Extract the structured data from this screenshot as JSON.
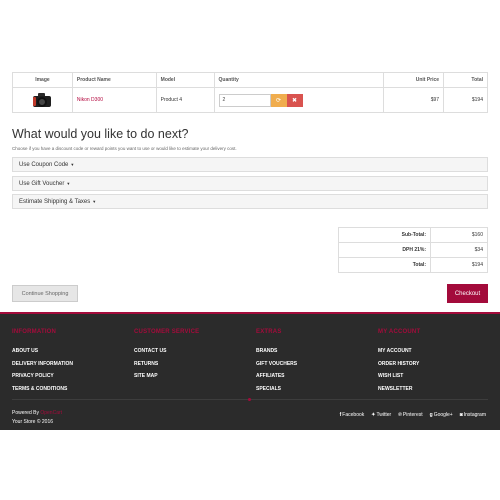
{
  "cart": {
    "columns": [
      "Image",
      "Product Name",
      "Model",
      "Quantity",
      "Unit Price",
      "Total"
    ],
    "rows": [
      {
        "image_icon": "camera-icon",
        "name": "Nikon D300",
        "model": "Product 4",
        "quantity": "2",
        "unit_price": "$97",
        "total": "$194"
      }
    ],
    "update_icon": "refresh-icon",
    "remove_icon": "remove-icon"
  },
  "next": {
    "title": "What would you like to do next?",
    "subtitle": "Choose if you have a discount code or reward points you want to use or would like to estimate your delivery cost.",
    "panels": [
      "Use Coupon Code",
      "Use Gift Voucher",
      "Estimate Shipping & Taxes"
    ]
  },
  "totals": [
    {
      "label": "Sub-Total:",
      "value": "$160"
    },
    {
      "label": "DPH 21%:",
      "value": "$34"
    },
    {
      "label": "Total:",
      "value": "$194"
    }
  ],
  "actions": {
    "continue_label": "Continue Shopping",
    "checkout_label": "Checkout"
  },
  "footer": {
    "columns": [
      {
        "heading": "INFORMATION",
        "links": [
          "ABOUT US",
          "DELIVERY INFORMATION",
          "PRIVACY POLICY",
          "TERMS & CONDITIONS"
        ]
      },
      {
        "heading": "CUSTOMER SERVICE",
        "links": [
          "CONTACT US",
          "RETURNS",
          "SITE MAP"
        ]
      },
      {
        "heading": "EXTRAS",
        "links": [
          "BRANDS",
          "GIFT VOUCHERS",
          "AFFILIATES",
          "SPECIALS"
        ]
      },
      {
        "heading": "MY ACCOUNT",
        "links": [
          "MY ACCOUNT",
          "ORDER HISTORY",
          "WISH LIST",
          "NEWSLETTER"
        ]
      }
    ],
    "powered_by": "Powered By",
    "powered_brand": "OpenCart",
    "store_line": "Your Store © 2016",
    "social": [
      {
        "icon": "f",
        "label": "Facebook"
      },
      {
        "icon": "t",
        "label": "Twitter"
      },
      {
        "icon": "p",
        "label": "Pinterest"
      },
      {
        "icon": "g",
        "label": "Google+"
      },
      {
        "icon": "i",
        "label": "Instagram"
      }
    ]
  },
  "colors": {
    "accent": "#a30b3b",
    "footer_bg": "#2b2b2b",
    "update_btn": "#f0ad4e",
    "remove_btn": "#d9534f"
  }
}
